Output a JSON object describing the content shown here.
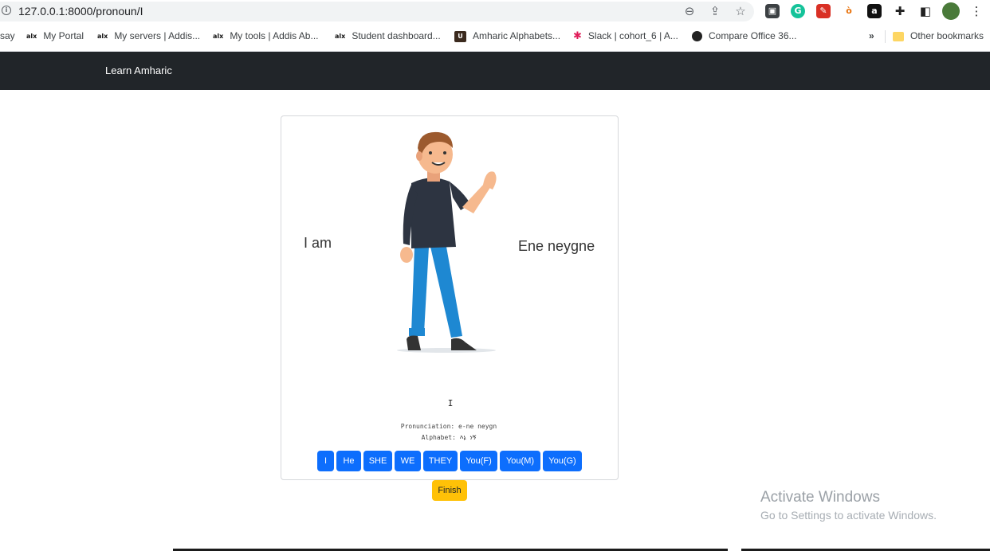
{
  "browser": {
    "url": "127.0.0.1:8000/pronoun/I",
    "bookmarks": [
      {
        "icon": "",
        "label": "say"
      },
      {
        "icon": "alx",
        "label": "My Portal"
      },
      {
        "icon": "alx",
        "label": "My servers | Addis..."
      },
      {
        "icon": "alx",
        "label": "My tools | Addis Ab..."
      },
      {
        "icon": "alx",
        "label": "Student dashboard..."
      },
      {
        "icon": "book-icon",
        "label": "Amharic Alphabets..."
      },
      {
        "icon": "slack-icon",
        "label": "Slack | cohort_6 | A..."
      },
      {
        "icon": "globe-icon",
        "label": "Compare Office 36..."
      }
    ],
    "overflow": "»",
    "other_bookmarks": "Other bookmarks"
  },
  "navbar": {
    "brand": "Learn Amharic"
  },
  "lesson": {
    "english": "I am",
    "amharic": "Ene neygne",
    "word": "I",
    "pronunciation_line": "Pronunciation: e-ne  neygn",
    "alphabet_line": "Alphabet: እኔ ነኝ"
  },
  "pronoun_buttons": [
    "I",
    "He",
    "SHE",
    "WE",
    "THEY",
    "You(F)",
    "You(M)",
    "You(G)"
  ],
  "finish_label": "Finish",
  "os": {
    "activate_title": "Activate Windows",
    "activate_sub": "Go to Settings to activate Windows."
  },
  "colors": {
    "navbar": "#212529",
    "primary": "#0d6efd",
    "warning": "#ffc107"
  }
}
